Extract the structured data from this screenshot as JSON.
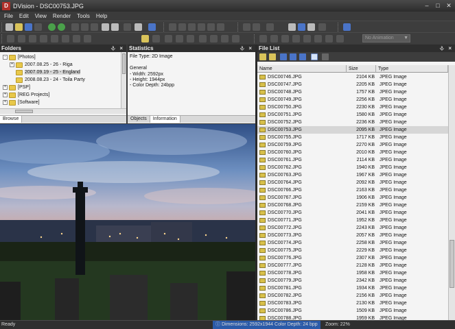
{
  "window": {
    "title": "DVision - DSC00753.JPG",
    "logo_letter": "D"
  },
  "menu": [
    "File",
    "Edit",
    "View",
    "Render",
    "Tools",
    "Help"
  ],
  "toolbar": {
    "animation_select": "No Animation"
  },
  "folders": {
    "title": "Folders",
    "items": [
      {
        "label": "[Photos]",
        "expander": "-"
      },
      {
        "label": "2007.08.25 - 26 - Riga",
        "expander": "+"
      },
      {
        "label": "2007.09.19 - 25 - England",
        "expander": "",
        "selected": true
      },
      {
        "label": "2008.08.23 - 24 - Toila Party",
        "expander": ""
      },
      {
        "label": "[PSP]",
        "expander": "+"
      },
      {
        "label": "[REG Projects]",
        "expander": "+"
      },
      {
        "label": "[Software]",
        "expander": "+"
      }
    ],
    "tabs": [
      "Browse"
    ]
  },
  "statistics": {
    "title": "Statistics",
    "lines": [
      "File Type: 2D Image",
      "",
      "General",
      "- Width: 2592px",
      "- Height: 1944px",
      "- Color Depth: 24bpp"
    ],
    "tabs": [
      "Objects",
      "Information"
    ]
  },
  "filelist": {
    "title": "File List",
    "columns": {
      "name": "Name",
      "size": "Size",
      "type": "Type"
    },
    "rows": [
      {
        "name": "DSC00746.JPG",
        "size": "2104 KB",
        "type": "JPEG Image"
      },
      {
        "name": "DSC00747.JPG",
        "size": "2205 KB",
        "type": "JPEG Image"
      },
      {
        "name": "DSC00748.JPG",
        "size": "1757 KB",
        "type": "JPEG Image"
      },
      {
        "name": "DSC00749.JPG",
        "size": "2256 KB",
        "type": "JPEG Image"
      },
      {
        "name": "DSC00750.JPG",
        "size": "2230 KB",
        "type": "JPEG Image"
      },
      {
        "name": "DSC00751.JPG",
        "size": "1580 KB",
        "type": "JPEG Image"
      },
      {
        "name": "DSC00752.JPG",
        "size": "2236 KB",
        "type": "JPEG Image"
      },
      {
        "name": "DSC00753.JPG",
        "size": "2095 KB",
        "type": "JPEG Image",
        "selected": true
      },
      {
        "name": "DSC00755.JPG",
        "size": "1717 KB",
        "type": "JPEG Image"
      },
      {
        "name": "DSC00759.JPG",
        "size": "2270 KB",
        "type": "JPEG Image"
      },
      {
        "name": "DSC00760.JPG",
        "size": "2010 KB",
        "type": "JPEG Image"
      },
      {
        "name": "DSC00761.JPG",
        "size": "2114 KB",
        "type": "JPEG Image"
      },
      {
        "name": "DSC00762.JPG",
        "size": "1940 KB",
        "type": "JPEG Image"
      },
      {
        "name": "DSC00763.JPG",
        "size": "1967 KB",
        "type": "JPEG Image"
      },
      {
        "name": "DSC00764.JPG",
        "size": "2092 KB",
        "type": "JPEG Image"
      },
      {
        "name": "DSC00766.JPG",
        "size": "2163 KB",
        "type": "JPEG Image"
      },
      {
        "name": "DSC00767.JPG",
        "size": "1906 KB",
        "type": "JPEG Image"
      },
      {
        "name": "DSC00768.JPG",
        "size": "2159 KB",
        "type": "JPEG Image"
      },
      {
        "name": "DSC00770.JPG",
        "size": "2041 KB",
        "type": "JPEG Image"
      },
      {
        "name": "DSC00771.JPG",
        "size": "1952 KB",
        "type": "JPEG Image"
      },
      {
        "name": "DSC00772.JPG",
        "size": "2243 KB",
        "type": "JPEG Image"
      },
      {
        "name": "DSC00773.JPG",
        "size": "2057 KB",
        "type": "JPEG Image"
      },
      {
        "name": "DSC00774.JPG",
        "size": "2258 KB",
        "type": "JPEG Image"
      },
      {
        "name": "DSC00775.JPG",
        "size": "2229 KB",
        "type": "JPEG Image"
      },
      {
        "name": "DSC00776.JPG",
        "size": "2307 KB",
        "type": "JPEG Image"
      },
      {
        "name": "DSC00777.JPG",
        "size": "2128 KB",
        "type": "JPEG Image"
      },
      {
        "name": "DSC00778.JPG",
        "size": "1958 KB",
        "type": "JPEG Image"
      },
      {
        "name": "DSC00779.JPG",
        "size": "2342 KB",
        "type": "JPEG Image"
      },
      {
        "name": "DSC00781.JPG",
        "size": "1934 KB",
        "type": "JPEG Image"
      },
      {
        "name": "DSC00782.JPG",
        "size": "2156 KB",
        "type": "JPEG Image"
      },
      {
        "name": "DSC00783.JPG",
        "size": "2130 KB",
        "type": "JPEG Image"
      },
      {
        "name": "DSC00786.JPG",
        "size": "1509 KB",
        "type": "JPEG Image"
      },
      {
        "name": "DSC00788.JPG",
        "size": "1959 KB",
        "type": "JPEG Image"
      }
    ]
  },
  "status": {
    "ready": "Ready",
    "dimensions": "Dimensions: 2592x1944",
    "color_depth": "Color Depth: 24 bpp",
    "zoom": "Zoom: 22%"
  },
  "icons": {
    "window_controls": [
      "minimize-icon",
      "maximize-icon",
      "close-icon"
    ],
    "panel_controls": [
      "pin-icon",
      "close-icon"
    ]
  }
}
